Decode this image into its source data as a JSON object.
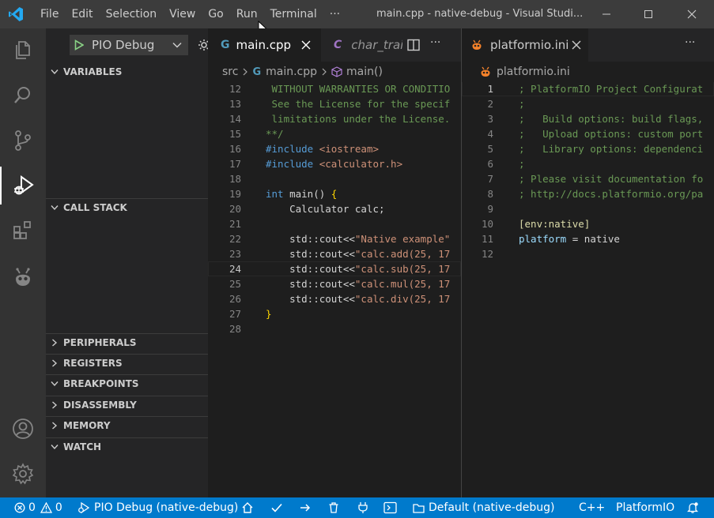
{
  "menu": [
    "File",
    "Edit",
    "Selection",
    "View",
    "Go",
    "Run",
    "Terminal",
    "···"
  ],
  "window_title": "main.cpp - native-debug - Visual Studi...",
  "debug": {
    "config": "PIO Debug"
  },
  "sidebar_sections": {
    "variables": "VARIABLES",
    "call_stack": "CALL STACK",
    "peripherals": "PERIPHERALS",
    "registers": "REGISTERS",
    "breakpoints": "BREAKPOINTS",
    "disassembly": "DISASSEMBLY",
    "memory": "MEMORY",
    "watch": "WATCH"
  },
  "editor1": {
    "tabs": [
      {
        "label": "main.cpp",
        "icon": "C++"
      },
      {
        "label": "char_trai",
        "icon": "C"
      }
    ],
    "breadcrumb": {
      "folder": "src",
      "file": "main.cpp",
      "symbol": "main()"
    },
    "lines": [
      {
        "n": "12",
        "parts": [
          {
            "t": " WITHOUT WARRANTIES OR CONDITIO",
            "c": "c-comment"
          }
        ]
      },
      {
        "n": "13",
        "parts": [
          {
            "t": " See the License for the specif",
            "c": "c-comment"
          }
        ]
      },
      {
        "n": "14",
        "parts": [
          {
            "t": " limitations under the License.",
            "c": "c-comment"
          }
        ]
      },
      {
        "n": "15",
        "parts": [
          {
            "t": "**/",
            "c": "c-comment"
          }
        ]
      },
      {
        "n": "16",
        "parts": [
          {
            "t": "#include ",
            "c": "c-pre"
          },
          {
            "t": "<iostream>",
            "c": "c-inc"
          }
        ]
      },
      {
        "n": "17",
        "parts": [
          {
            "t": "#include ",
            "c": "c-pre"
          },
          {
            "t": "<calculator.h>",
            "c": "c-inc"
          }
        ]
      },
      {
        "n": "18",
        "parts": []
      },
      {
        "n": "19",
        "parts": [
          {
            "t": "int",
            "c": "c-kw"
          },
          {
            "t": " main() ",
            "c": "c-plain"
          },
          {
            "t": "{",
            "c": "c-brace"
          }
        ]
      },
      {
        "n": "20",
        "parts": [
          {
            "t": "    Calculator calc;",
            "c": "c-plain"
          }
        ]
      },
      {
        "n": "21",
        "parts": []
      },
      {
        "n": "22",
        "parts": [
          {
            "t": "    std::cout<<",
            "c": "c-plain"
          },
          {
            "t": "\"Native example\"",
            "c": "c-str"
          }
        ]
      },
      {
        "n": "23",
        "parts": [
          {
            "t": "    std::cout<<",
            "c": "c-plain"
          },
          {
            "t": "\"calc.add(25, 17",
            "c": "c-str"
          }
        ]
      },
      {
        "n": "24",
        "parts": [
          {
            "t": "    std::cout<<",
            "c": "c-plain"
          },
          {
            "t": "\"calc.sub(25, 17",
            "c": "c-str"
          }
        ]
      },
      {
        "n": "25",
        "parts": [
          {
            "t": "    std::cout<<",
            "c": "c-plain"
          },
          {
            "t": "\"calc.mul(25, 17",
            "c": "c-str"
          }
        ]
      },
      {
        "n": "26",
        "parts": [
          {
            "t": "    std::cout<<",
            "c": "c-plain"
          },
          {
            "t": "\"calc.div(25, 17",
            "c": "c-str"
          }
        ]
      },
      {
        "n": "27",
        "parts": [
          {
            "t": "}",
            "c": "c-brace"
          }
        ]
      },
      {
        "n": "28",
        "parts": []
      }
    ],
    "current_line": "24"
  },
  "editor2": {
    "tab": "platformio.ini",
    "breadcrumb": "platformio.ini",
    "lines": [
      {
        "n": "1",
        "parts": [
          {
            "t": "; PlatformIO Project Configurat",
            "c": "c-comment"
          }
        ]
      },
      {
        "n": "2",
        "parts": [
          {
            "t": ";",
            "c": "c-comment"
          }
        ]
      },
      {
        "n": "3",
        "parts": [
          {
            "t": ";   Build options: build flags,",
            "c": "c-comment"
          }
        ]
      },
      {
        "n": "4",
        "parts": [
          {
            "t": ";   Upload options: custom port",
            "c": "c-comment"
          }
        ]
      },
      {
        "n": "5",
        "parts": [
          {
            "t": ";   Library options: dependenci",
            "c": "c-comment"
          }
        ]
      },
      {
        "n": "6",
        "parts": [
          {
            "t": ";",
            "c": "c-comment"
          }
        ]
      },
      {
        "n": "7",
        "parts": [
          {
            "t": "; Please visit documentation fo",
            "c": "c-comment"
          }
        ]
      },
      {
        "n": "8",
        "parts": [
          {
            "t": "; http://docs.platformio.org/pa",
            "c": "c-comment"
          }
        ]
      },
      {
        "n": "9",
        "parts": []
      },
      {
        "n": "10",
        "parts": [
          {
            "t": "[env:native]",
            "c": "c-section"
          }
        ]
      },
      {
        "n": "11",
        "parts": [
          {
            "t": "platform",
            "c": "c-key"
          },
          {
            "t": " = native",
            "c": "c-plain"
          }
        ]
      },
      {
        "n": "12",
        "parts": []
      }
    ]
  },
  "status": {
    "errors": "0",
    "warnings": "0",
    "debug_session": "PIO Debug (native-debug)",
    "environment": "Default (native-debug)",
    "language": "C++",
    "platformio": "PlatformIO"
  },
  "colors": {
    "accent": "#007acc",
    "titlebar": "#3c3c3c",
    "activitybar": "#333333",
    "sidebar": "#252526",
    "editor": "#1e1e1e"
  }
}
